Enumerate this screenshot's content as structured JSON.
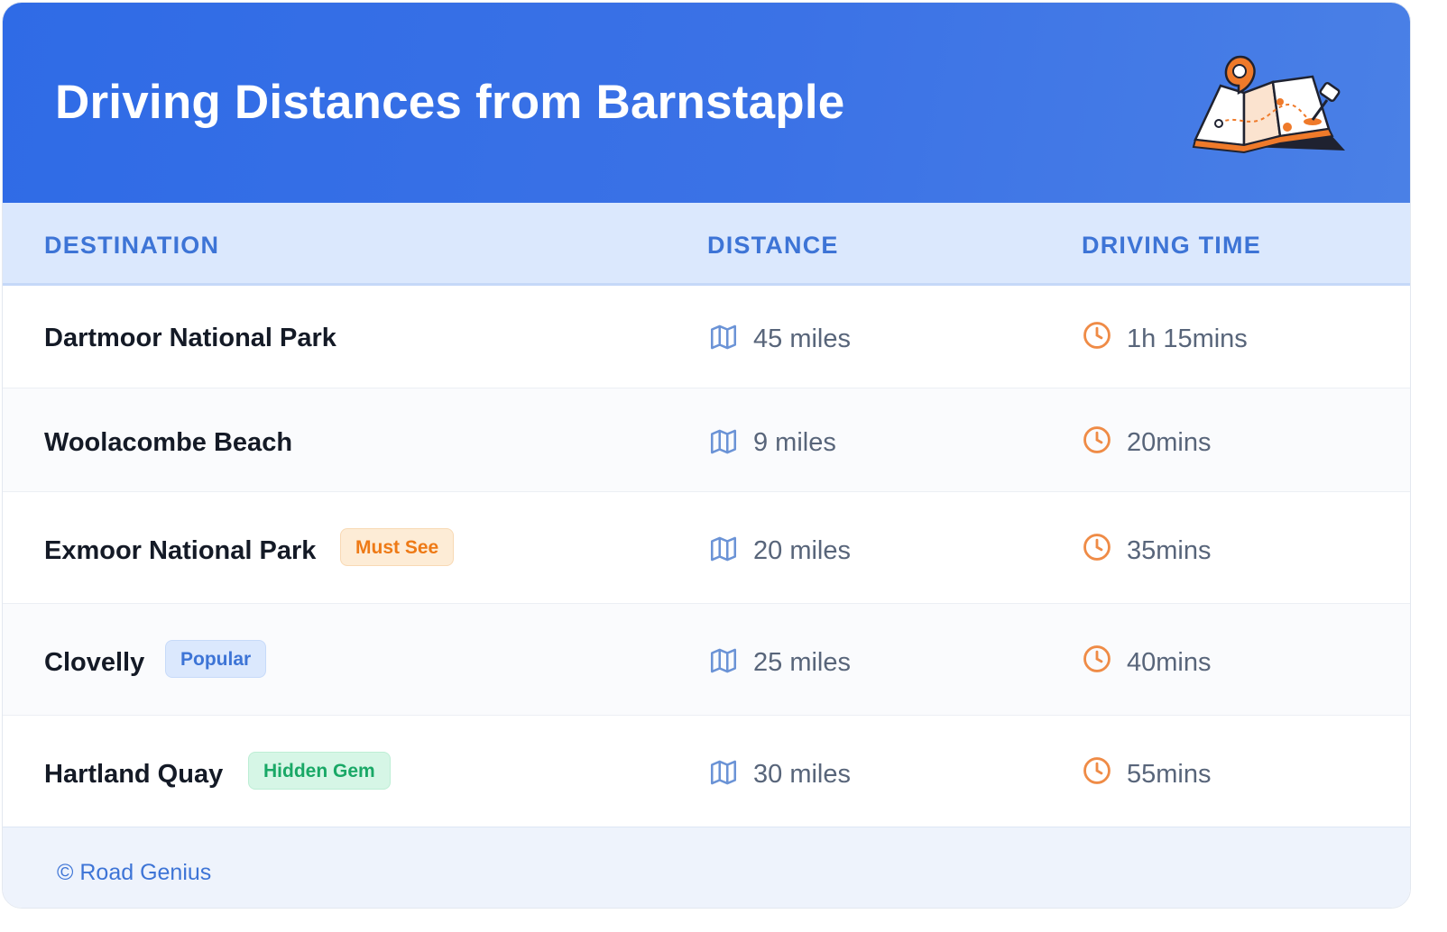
{
  "header": {
    "title": "Driving Distances from Barnstaple",
    "illustration_icon": "folded-map-with-pins-icon"
  },
  "table": {
    "columns": [
      "DESTINATION",
      "DISTANCE",
      "DRIVING TIME"
    ],
    "distance_icon": "map-icon",
    "time_icon": "clock-icon",
    "rows": [
      {
        "destination": "Dartmoor National Park",
        "badge": "",
        "distance": "45 miles",
        "time": "1h 15mins"
      },
      {
        "destination": "Woolacombe Beach",
        "badge": "",
        "distance": "9 miles",
        "time": "20mins"
      },
      {
        "destination": "Exmoor National Park",
        "badge": "Must See",
        "distance": "20 miles",
        "time": "35mins"
      },
      {
        "destination": "Clovelly",
        "badge": "Popular",
        "distance": "25 miles",
        "time": "40mins"
      },
      {
        "destination": "Hartland Quay",
        "badge": "Hidden Gem",
        "distance": "30 miles",
        "time": "55mins"
      }
    ]
  },
  "footer": {
    "credit": "© Road Genius"
  },
  "colors": {
    "header_gradient_start": "#2f6be6",
    "header_gradient_end": "#4a80e6",
    "column_header_text": "#3d74d6",
    "badge_must_see": "#ee7a16",
    "badge_popular": "#3d74d6",
    "badge_hidden_gem": "#19a866",
    "map_icon": "#6b93d6",
    "clock_icon": "#ef8b46"
  }
}
